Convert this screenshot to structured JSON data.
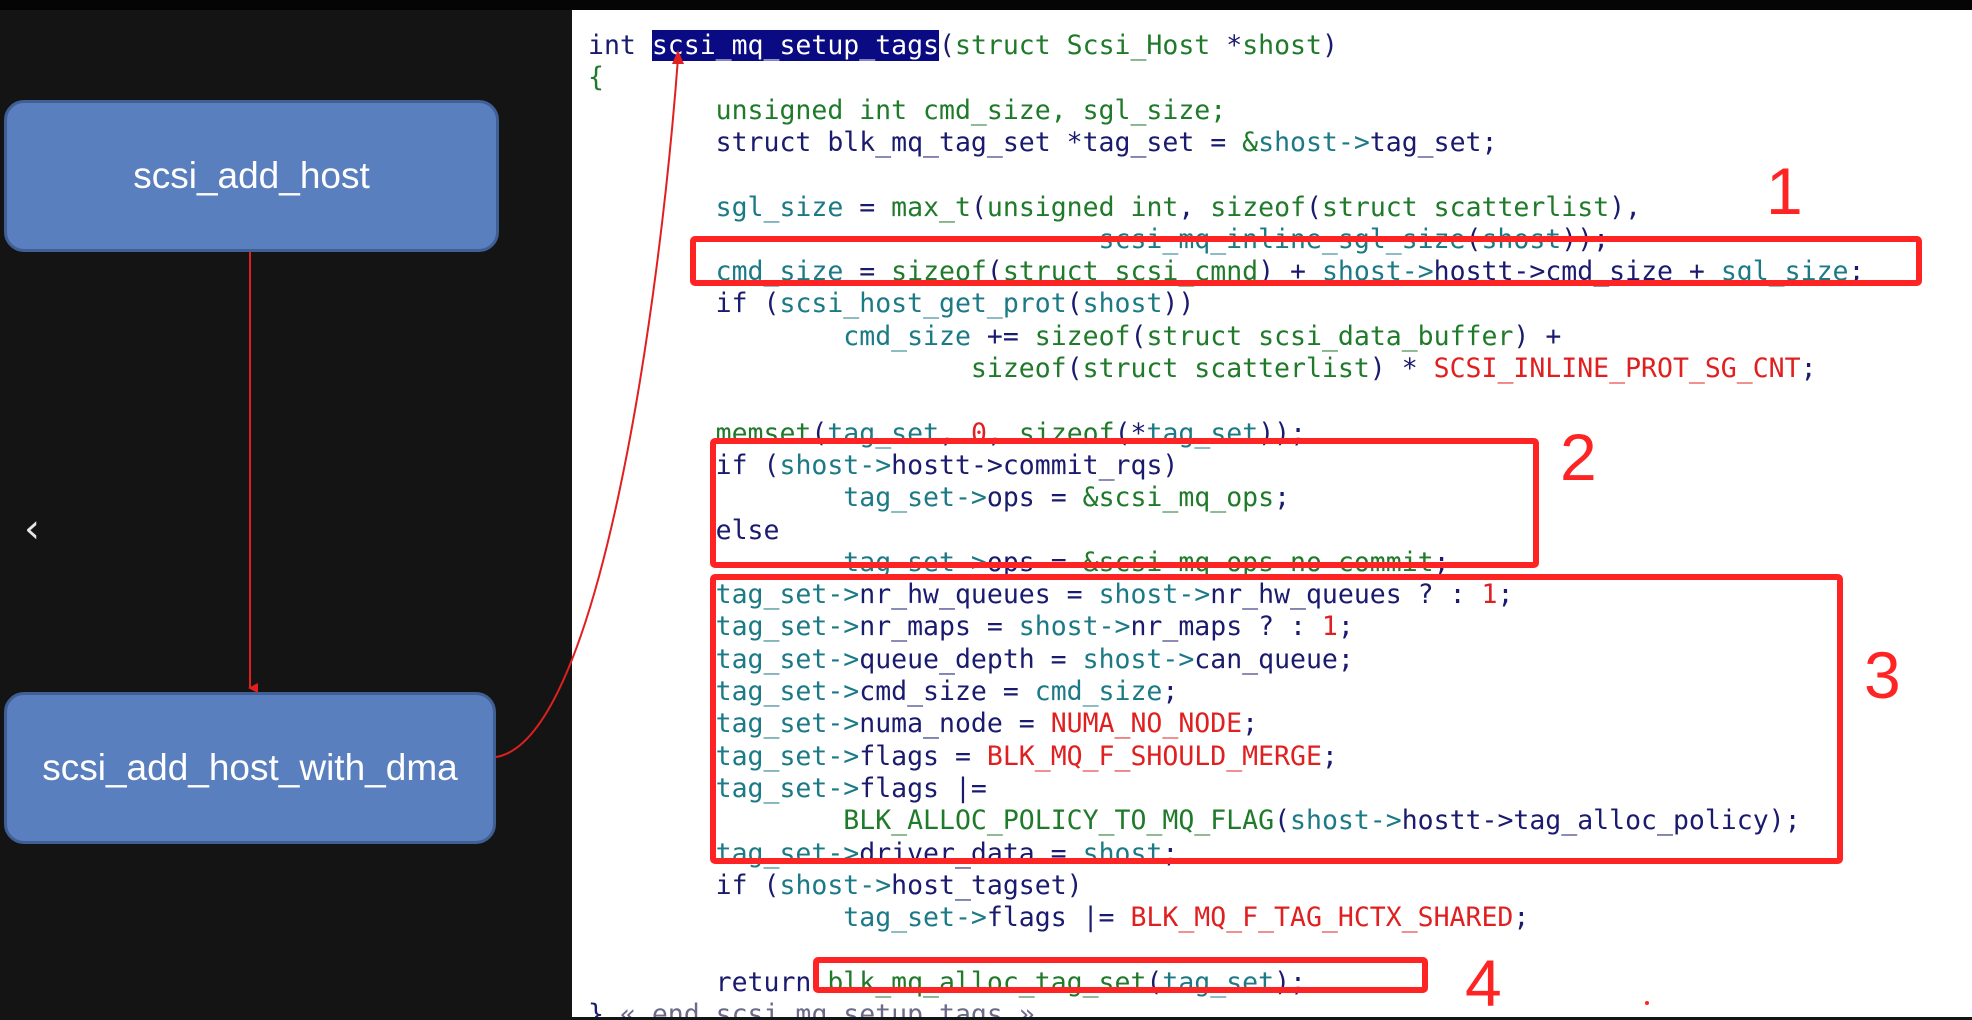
{
  "diagram": {
    "nodes": [
      {
        "id": "scsi_add_host",
        "label": "scsi_add_host"
      },
      {
        "id": "scsi_add_host_with_dma",
        "label": "scsi_add_host_with_dma"
      }
    ],
    "edges": [
      {
        "from": "scsi_add_host",
        "to": "scsi_add_host_with_dma"
      },
      {
        "from": "scsi_add_host_with_dma",
        "to": "scsi_mq_setup_tags"
      }
    ],
    "colors": {
      "node_fill": "#5a7fbf",
      "arrow": "#e02020",
      "highlight_box": "#ff2424"
    }
  },
  "nav": {
    "prev_icon": "chevron-left-icon",
    "prev_glyph": "‹"
  },
  "code": {
    "lines": [
      [
        [
          "kw",
          "int "
        ],
        [
          "sel",
          "scsi_mq_setup_tags"
        ],
        [
          "plain",
          "("
        ],
        [
          "ty",
          "struct Scsi_Host"
        ],
        [
          "plain",
          " *"
        ],
        [
          "ty",
          "shost"
        ],
        [
          "plain",
          ")"
        ]
      ],
      [
        [
          "ty",
          "{"
        ]
      ],
      [
        [
          "plain",
          "        "
        ],
        [
          "ty",
          "unsigned int cmd_size, sgl_size;"
        ]
      ],
      [
        [
          "plain",
          "        "
        ],
        [
          "kw",
          "struct blk_mq_tag_set *tag_set = "
        ],
        [
          "ty",
          "&"
        ],
        [
          "id",
          "shost->"
        ],
        [
          "plain",
          "tag_set;"
        ]
      ],
      [],
      [
        [
          "plain",
          "        "
        ],
        [
          "id",
          "sgl_size"
        ],
        [
          "plain",
          " = "
        ],
        [
          "ty",
          "max_t"
        ],
        [
          "plain",
          "("
        ],
        [
          "ty",
          "unsigned int"
        ],
        [
          "plain",
          ", "
        ],
        [
          "ty",
          "sizeof"
        ],
        [
          "plain",
          "("
        ],
        [
          "ty",
          "struct scatterlist"
        ],
        [
          "plain",
          "),"
        ]
      ],
      [
        [
          "plain",
          "                                "
        ],
        [
          "id",
          "scsi_mq_inline_sgl_size"
        ],
        [
          "plain",
          "("
        ],
        [
          "id",
          "shost"
        ],
        [
          "plain",
          "));"
        ]
      ],
      [
        [
          "plain",
          "        "
        ],
        [
          "id",
          "cmd_size"
        ],
        [
          "plain",
          " = "
        ],
        [
          "ty",
          "sizeof"
        ],
        [
          "plain",
          "("
        ],
        [
          "ty",
          "struct scsi_cmnd"
        ],
        [
          "plain",
          ") + "
        ],
        [
          "id",
          "shost->"
        ],
        [
          "plain",
          "hostt->cmd_size + "
        ],
        [
          "id",
          "sgl_size"
        ],
        [
          "plain",
          ";"
        ]
      ],
      [
        [
          "plain",
          "        "
        ],
        [
          "kw",
          "if "
        ],
        [
          "plain",
          "("
        ],
        [
          "id",
          "scsi_host_get_prot"
        ],
        [
          "plain",
          "("
        ],
        [
          "id",
          "shost"
        ],
        [
          "plain",
          "))"
        ]
      ],
      [
        [
          "plain",
          "                "
        ],
        [
          "id",
          "cmd_size"
        ],
        [
          "plain",
          " += "
        ],
        [
          "ty",
          "sizeof"
        ],
        [
          "plain",
          "("
        ],
        [
          "ty",
          "struct scsi_data_buffer"
        ],
        [
          "plain",
          ") +"
        ]
      ],
      [
        [
          "plain",
          "                        "
        ],
        [
          "ty",
          "sizeof"
        ],
        [
          "plain",
          "("
        ],
        [
          "ty",
          "struct scatterlist"
        ],
        [
          "plain",
          ") * "
        ],
        [
          "mac",
          "SCSI_INLINE_PROT_SG_CNT"
        ],
        [
          "plain",
          ";"
        ]
      ],
      [],
      [
        [
          "plain",
          "        "
        ],
        [
          "ty",
          "memset"
        ],
        [
          "plain",
          "("
        ],
        [
          "id",
          "tag_set"
        ],
        [
          "plain",
          ", "
        ],
        [
          "num",
          "0"
        ],
        [
          "plain",
          ", "
        ],
        [
          "ty",
          "sizeof"
        ],
        [
          "plain",
          "(*"
        ],
        [
          "id",
          "tag_set"
        ],
        [
          "plain",
          "));"
        ]
      ],
      [
        [
          "plain",
          "        "
        ],
        [
          "kw",
          "if "
        ],
        [
          "plain",
          "("
        ],
        [
          "id",
          "shost->"
        ],
        [
          "plain",
          "hostt->commit_rqs)"
        ]
      ],
      [
        [
          "plain",
          "                "
        ],
        [
          "id",
          "tag_set->"
        ],
        [
          "plain",
          "ops = "
        ],
        [
          "ty",
          "&scsi_mq_ops"
        ],
        [
          "plain",
          ";"
        ]
      ],
      [
        [
          "plain",
          "        "
        ],
        [
          "kw",
          "else"
        ]
      ],
      [
        [
          "plain",
          "                "
        ],
        [
          "id",
          "tag_set->"
        ],
        [
          "plain",
          "ops = "
        ],
        [
          "ty",
          "&scsi_mq_ops_no_commit"
        ],
        [
          "plain",
          ";"
        ]
      ],
      [
        [
          "plain",
          "        "
        ],
        [
          "id",
          "tag_set->"
        ],
        [
          "plain",
          "nr_hw_queues = "
        ],
        [
          "id",
          "shost->"
        ],
        [
          "plain",
          "nr_hw_queues ? : "
        ],
        [
          "num",
          "1"
        ],
        [
          "plain",
          ";"
        ]
      ],
      [
        [
          "plain",
          "        "
        ],
        [
          "id",
          "tag_set->"
        ],
        [
          "plain",
          "nr_maps = "
        ],
        [
          "id",
          "shost->"
        ],
        [
          "plain",
          "nr_maps ? : "
        ],
        [
          "num",
          "1"
        ],
        [
          "plain",
          ";"
        ]
      ],
      [
        [
          "plain",
          "        "
        ],
        [
          "id",
          "tag_set->"
        ],
        [
          "plain",
          "queue_depth = "
        ],
        [
          "id",
          "shost->"
        ],
        [
          "plain",
          "can_queue;"
        ]
      ],
      [
        [
          "plain",
          "        "
        ],
        [
          "id",
          "tag_set->"
        ],
        [
          "plain",
          "cmd_size = "
        ],
        [
          "id",
          "cmd_size"
        ],
        [
          "plain",
          ";"
        ]
      ],
      [
        [
          "plain",
          "        "
        ],
        [
          "id",
          "tag_set->"
        ],
        [
          "plain",
          "numa_node = "
        ],
        [
          "mac",
          "NUMA_NO_NODE"
        ],
        [
          "plain",
          ";"
        ]
      ],
      [
        [
          "plain",
          "        "
        ],
        [
          "id",
          "tag_set->"
        ],
        [
          "plain",
          "flags = "
        ],
        [
          "mac",
          "BLK_MQ_F_SHOULD_MERGE"
        ],
        [
          "plain",
          ";"
        ]
      ],
      [
        [
          "plain",
          "        "
        ],
        [
          "id",
          "tag_set->"
        ],
        [
          "plain",
          "flags |="
        ]
      ],
      [
        [
          "plain",
          "                "
        ],
        [
          "ty",
          "BLK_ALLOC_POLICY_TO_MQ_FLAG"
        ],
        [
          "plain",
          "("
        ],
        [
          "id",
          "shost->"
        ],
        [
          "plain",
          "hostt->tag_alloc_policy);"
        ]
      ],
      [
        [
          "plain",
          "        "
        ],
        [
          "id",
          "tag_set->"
        ],
        [
          "plain",
          "driver_data = "
        ],
        [
          "id",
          "shost"
        ],
        [
          "plain",
          ";"
        ]
      ],
      [
        [
          "plain",
          "        "
        ],
        [
          "kw",
          "if "
        ],
        [
          "plain",
          "("
        ],
        [
          "id",
          "shost->"
        ],
        [
          "plain",
          "host_tagset)"
        ]
      ],
      [
        [
          "plain",
          "                "
        ],
        [
          "id",
          "tag_set->"
        ],
        [
          "plain",
          "flags |= "
        ],
        [
          "mac",
          "BLK_MQ_F_TAG_HCTX_SHARED"
        ],
        [
          "plain",
          ";"
        ]
      ],
      [],
      [
        [
          "plain",
          "        "
        ],
        [
          "kw",
          "return "
        ],
        [
          "ty",
          "blk_mq_alloc_tag_set"
        ],
        [
          "plain",
          "("
        ],
        [
          "id",
          "tag_set"
        ],
        [
          "plain",
          ");"
        ]
      ],
      [
        [
          "plain",
          "} "
        ],
        [
          "cmt",
          "« end scsi_mq_setup_tags »"
        ]
      ]
    ]
  },
  "annotations": [
    {
      "label": "1"
    },
    {
      "label": "2"
    },
    {
      "label": "3"
    },
    {
      "label": "4"
    }
  ]
}
